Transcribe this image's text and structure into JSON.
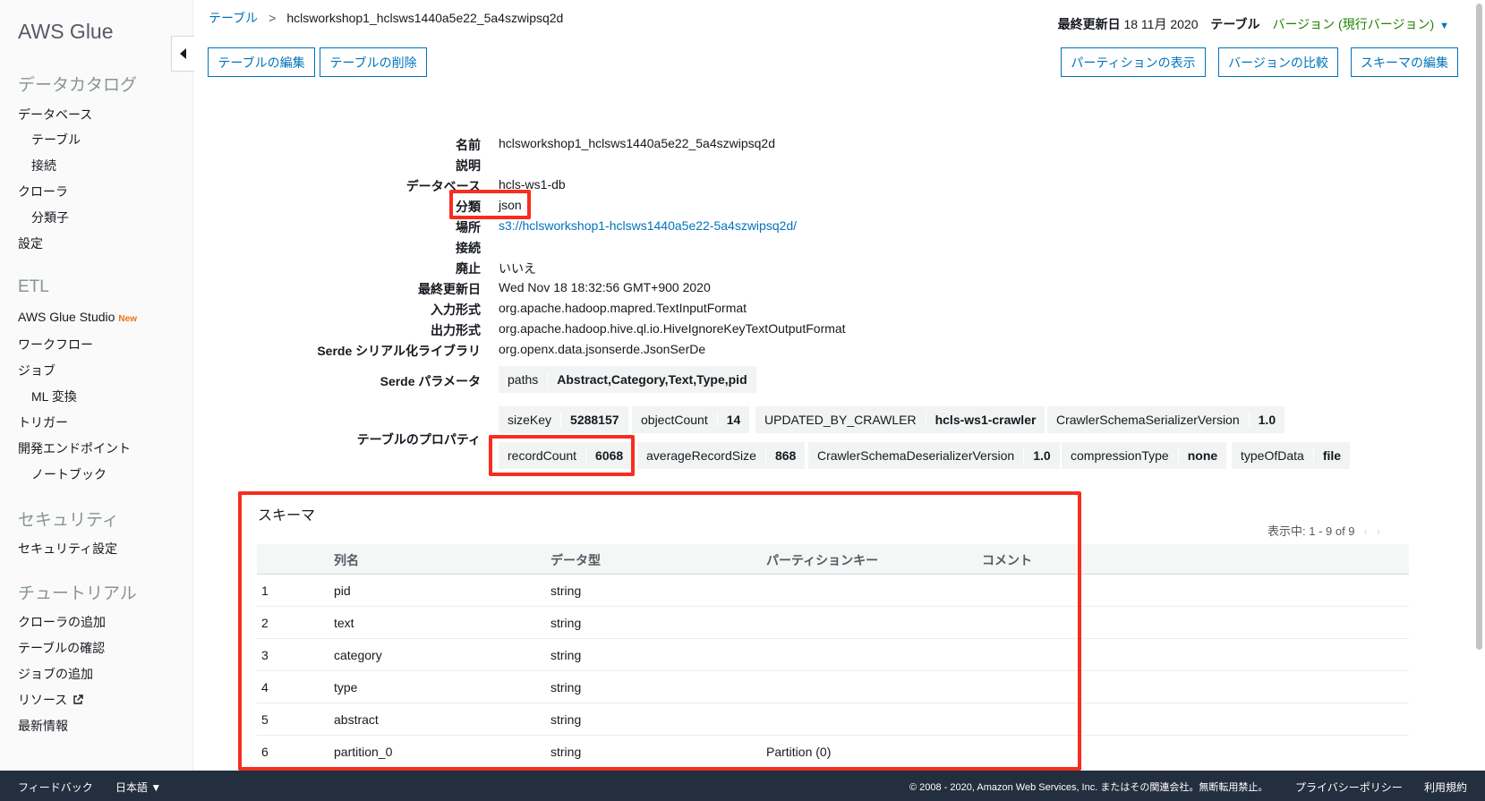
{
  "sidebar": {
    "brand": "AWS Glue",
    "data_catalog": "データカタログ",
    "databases": "データベース",
    "tables": "テーブル",
    "connections": "接続",
    "crawlers": "クローラ",
    "classifiers": "分類子",
    "settings": "設定",
    "etl": "ETL",
    "glue_studio": "AWS Glue Studio",
    "new_badge": "New",
    "workflows": "ワークフロー",
    "jobs": "ジョブ",
    "ml_transforms": "ML 変換",
    "triggers": "トリガー",
    "dev_endpoints": "開発エンドポイント",
    "notebooks": "ノートブック",
    "security": "セキュリティ",
    "security_settings": "セキュリティ設定",
    "tutorials": "チュートリアル",
    "add_crawler": "クローラの追加",
    "explore_table": "テーブルの確認",
    "add_job": "ジョブの追加",
    "resources": "リソース",
    "whats_new": "最新情報"
  },
  "header": {
    "breadcrumb_root": "テーブル",
    "breadcrumb_sep": ">",
    "breadcrumb_current": "hclsworkshop1_hclsws1440a5e22_5a4szwipsq2d",
    "last_updated_label": "最終更新日",
    "last_updated_value": "18 11月 2020",
    "table_label": "テーブル",
    "version_value": "バージョン (現行バージョン)"
  },
  "buttons": {
    "edit_table": "テーブルの編集",
    "delete_table": "テーブルの削除",
    "view_partitions": "パーティションの表示",
    "compare_versions": "バージョンの比較",
    "edit_schema": "スキーマの編集"
  },
  "details": {
    "name_label": "名前",
    "name_value": "hclsworkshop1_hclsws1440a5e22_5a4szwipsq2d",
    "description_label": "説明",
    "description_value": "",
    "database_label": "データベース",
    "database_value": "hcls-ws1-db",
    "classification_label": "分類",
    "classification_value": "json",
    "location_label": "場所",
    "location_value": "s3://hclsworkshop1-hclsws1440a5e22-5a4szwipsq2d/",
    "connection_label": "接続",
    "connection_value": "",
    "deprecated_label": "廃止",
    "deprecated_value": "いいえ",
    "last_updated_label": "最終更新日",
    "last_updated_value": "Wed Nov 18 18:32:56 GMT+900 2020",
    "input_format_label": "入力形式",
    "input_format_value": "org.apache.hadoop.mapred.TextInputFormat",
    "output_format_label": "出力形式",
    "output_format_value": "org.apache.hadoop.hive.ql.io.HiveIgnoreKeyTextOutputFormat",
    "serde_lib_label": "Serde シリアル化ライブラリ",
    "serde_lib_value": "org.openx.data.jsonserde.JsonSerDe",
    "serde_params_label": "Serde パラメータ",
    "serde_params": [
      {
        "key": "paths",
        "value": "Abstract,Category,Text,Type,pid"
      }
    ],
    "table_props_label": "テーブルのプロパティ",
    "table_props": [
      {
        "key": "sizeKey",
        "value": "5288157"
      },
      {
        "key": "objectCount",
        "value": "14"
      },
      {
        "key": "UPDATED_BY_CRAWLER",
        "value": "hcls-ws1-crawler"
      },
      {
        "key": "CrawlerSchemaSerializerVersion",
        "value": "1.0"
      },
      {
        "key": "recordCount",
        "value": "6068"
      },
      {
        "key": "averageRecordSize",
        "value": "868"
      },
      {
        "key": "CrawlerSchemaDeserializerVersion",
        "value": "1.0"
      },
      {
        "key": "compressionType",
        "value": "none"
      },
      {
        "key": "typeOfData",
        "value": "file"
      }
    ]
  },
  "schema": {
    "title": "スキーマ",
    "pager": "表示中: 1 - 9 of 9",
    "columns": [
      "",
      "列名",
      "データ型",
      "パーティションキー",
      "コメント"
    ],
    "rows": [
      [
        "1",
        "pid",
        "string",
        "",
        ""
      ],
      [
        "2",
        "text",
        "string",
        "",
        ""
      ],
      [
        "3",
        "category",
        "string",
        "",
        ""
      ],
      [
        "4",
        "type",
        "string",
        "",
        ""
      ],
      [
        "5",
        "abstract",
        "string",
        "",
        ""
      ],
      [
        "6",
        "partition_0",
        "string",
        "Partition (0)",
        ""
      ]
    ]
  },
  "footer": {
    "feedback": "フィードバック",
    "language": "日本語",
    "copyright": "© 2008 - 2020, Amazon Web Services, Inc. またはその関連会社。無断転用禁止。",
    "privacy": "プライバシーポリシー",
    "terms": "利用規約"
  },
  "colors": {
    "link": "#0073bb",
    "highlight_box": "#f72d1f",
    "footer_bg": "#232f3e",
    "version_green": "#1d8102"
  }
}
